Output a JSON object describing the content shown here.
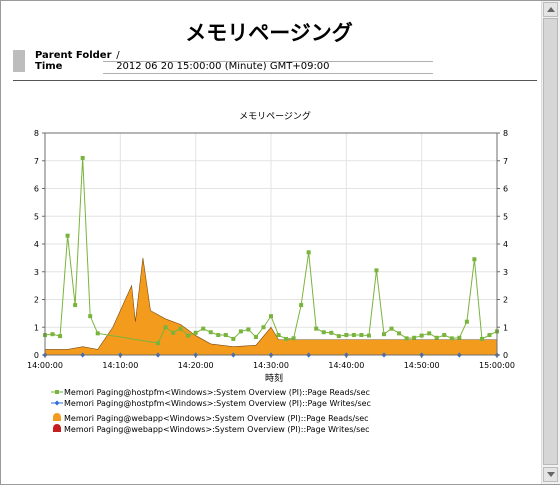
{
  "report": {
    "title": "メモリページング",
    "parent_folder_label": "Parent Folder",
    "parent_folder_value": "/",
    "time_label": "Time",
    "time_value": "2012 06 20 15:00:00  (Minute)  GMT+09:00"
  },
  "chart_data": {
    "type": "line",
    "title": "メモリページング",
    "xlabel": "時刻",
    "ylabel": "",
    "ylim": [
      0,
      8
    ],
    "y_ticks": [
      "0",
      "1",
      "2",
      "3",
      "4",
      "5",
      "6",
      "7",
      "8"
    ],
    "xlim": [
      "14:00:00",
      "15:00:00"
    ],
    "x_ticks": [
      "14:00:00",
      "14:10:00",
      "14:20:00",
      "14:30:00",
      "14:40:00",
      "14:50:00",
      "15:00:00"
    ],
    "grid": true,
    "legend_position": "bottom",
    "series": [
      {
        "name": "Memori Paging@hostpfm<Windows>:System Overview (PI)::Page Reads/sec",
        "kind": "line",
        "marker": "square",
        "color": "#78b43c",
        "points": [
          [
            "14:00:00",
            0.72
          ],
          [
            "14:01:00",
            0.75
          ],
          [
            "14:02:00",
            0.68
          ],
          [
            "14:03:00",
            4.3
          ],
          [
            "14:04:00",
            1.8
          ],
          [
            "14:05:00",
            7.1
          ],
          [
            "14:06:00",
            1.4
          ],
          [
            "14:07:00",
            0.78
          ],
          [
            "14:15:00",
            0.43
          ],
          [
            "14:16:00",
            1.0
          ],
          [
            "14:17:00",
            0.8
          ],
          [
            "14:18:00",
            0.95
          ],
          [
            "14:19:00",
            0.7
          ],
          [
            "14:20:00",
            0.8
          ],
          [
            "14:21:00",
            0.95
          ],
          [
            "14:22:00",
            0.82
          ],
          [
            "14:23:00",
            0.72
          ],
          [
            "14:24:00",
            0.72
          ],
          [
            "14:25:00",
            0.58
          ],
          [
            "14:26:00",
            0.85
          ],
          [
            "14:27:00",
            0.92
          ],
          [
            "14:28:00",
            0.65
          ],
          [
            "14:29:00",
            1.0
          ],
          [
            "14:30:00",
            1.4
          ],
          [
            "14:31:00",
            0.72
          ],
          [
            "14:32:00",
            0.58
          ],
          [
            "14:33:00",
            0.6
          ],
          [
            "14:34:00",
            1.8
          ],
          [
            "14:35:00",
            3.7
          ],
          [
            "14:36:00",
            0.95
          ],
          [
            "14:37:00",
            0.82
          ],
          [
            "14:38:00",
            0.8
          ],
          [
            "14:39:00",
            0.68
          ],
          [
            "14:40:00",
            0.72
          ],
          [
            "14:41:00",
            0.72
          ],
          [
            "14:42:00",
            0.72
          ],
          [
            "14:43:00",
            0.7
          ],
          [
            "14:44:00",
            3.05
          ],
          [
            "14:45:00",
            0.75
          ],
          [
            "14:46:00",
            0.95
          ],
          [
            "14:47:00",
            0.78
          ],
          [
            "14:48:00",
            0.6
          ],
          [
            "14:49:00",
            0.62
          ],
          [
            "14:50:00",
            0.7
          ],
          [
            "14:51:00",
            0.78
          ],
          [
            "14:52:00",
            0.62
          ],
          [
            "14:53:00",
            0.72
          ],
          [
            "14:54:00",
            0.6
          ],
          [
            "14:55:00",
            0.62
          ],
          [
            "14:56:00",
            1.2
          ],
          [
            "14:57:00",
            3.45
          ],
          [
            "14:58:00",
            0.58
          ],
          [
            "14:59:00",
            0.72
          ],
          [
            "15:00:00",
            0.85
          ]
        ]
      },
      {
        "name": "Memori Paging@hostpfm<Windows>:System Overview (PI)::Page Writes/sec",
        "kind": "line",
        "marker": "diamond",
        "color": "#2f6fd6",
        "points": [
          [
            "14:00:00",
            0.0
          ],
          [
            "14:05:00",
            0.0
          ],
          [
            "14:10:00",
            0.0
          ],
          [
            "14:15:00",
            0.0
          ],
          [
            "14:20:00",
            0.0
          ],
          [
            "14:25:00",
            0.0
          ],
          [
            "14:30:00",
            0.0
          ],
          [
            "14:35:00",
            0.0
          ],
          [
            "14:40:00",
            0.0
          ],
          [
            "14:45:00",
            0.0
          ],
          [
            "14:50:00",
            0.0
          ],
          [
            "14:55:00",
            0.0
          ],
          [
            "15:00:00",
            0.0
          ]
        ]
      },
      {
        "name": "Memori Paging@webapp<Windows>:System Overview (PI)::Page Reads/sec",
        "kind": "area",
        "marker": "bell",
        "color": "#f29b1d",
        "points": [
          [
            "14:00:00",
            0.2
          ],
          [
            "14:03:00",
            0.2
          ],
          [
            "14:05:00",
            0.3
          ],
          [
            "14:07:00",
            0.2
          ],
          [
            "14:09:00",
            1.0
          ],
          [
            "14:11:30",
            2.5
          ],
          [
            "14:12:00",
            1.2
          ],
          [
            "14:13:00",
            3.5
          ],
          [
            "14:14:00",
            1.6
          ],
          [
            "14:16:00",
            1.3
          ],
          [
            "14:18:00",
            1.1
          ],
          [
            "14:20:00",
            0.7
          ],
          [
            "14:22:00",
            0.4
          ],
          [
            "14:25:00",
            0.3
          ],
          [
            "14:28:00",
            0.35
          ],
          [
            "14:30:00",
            1.0
          ],
          [
            "14:31:00",
            0.55
          ],
          [
            "14:33:00",
            0.55
          ],
          [
            "14:36:00",
            0.55
          ],
          [
            "14:40:00",
            0.55
          ],
          [
            "14:45:00",
            0.55
          ],
          [
            "14:50:00",
            0.55
          ],
          [
            "14:55:00",
            0.55
          ],
          [
            "15:00:00",
            0.55
          ]
        ]
      },
      {
        "name": "Memori Paging@webapp<Windows>:System Overview (PI)::Page Writes/sec",
        "kind": "area",
        "marker": "bell",
        "color": "#c41e1e",
        "points": [
          [
            "14:00:00",
            0.0
          ],
          [
            "15:00:00",
            0.0
          ]
        ]
      }
    ]
  }
}
